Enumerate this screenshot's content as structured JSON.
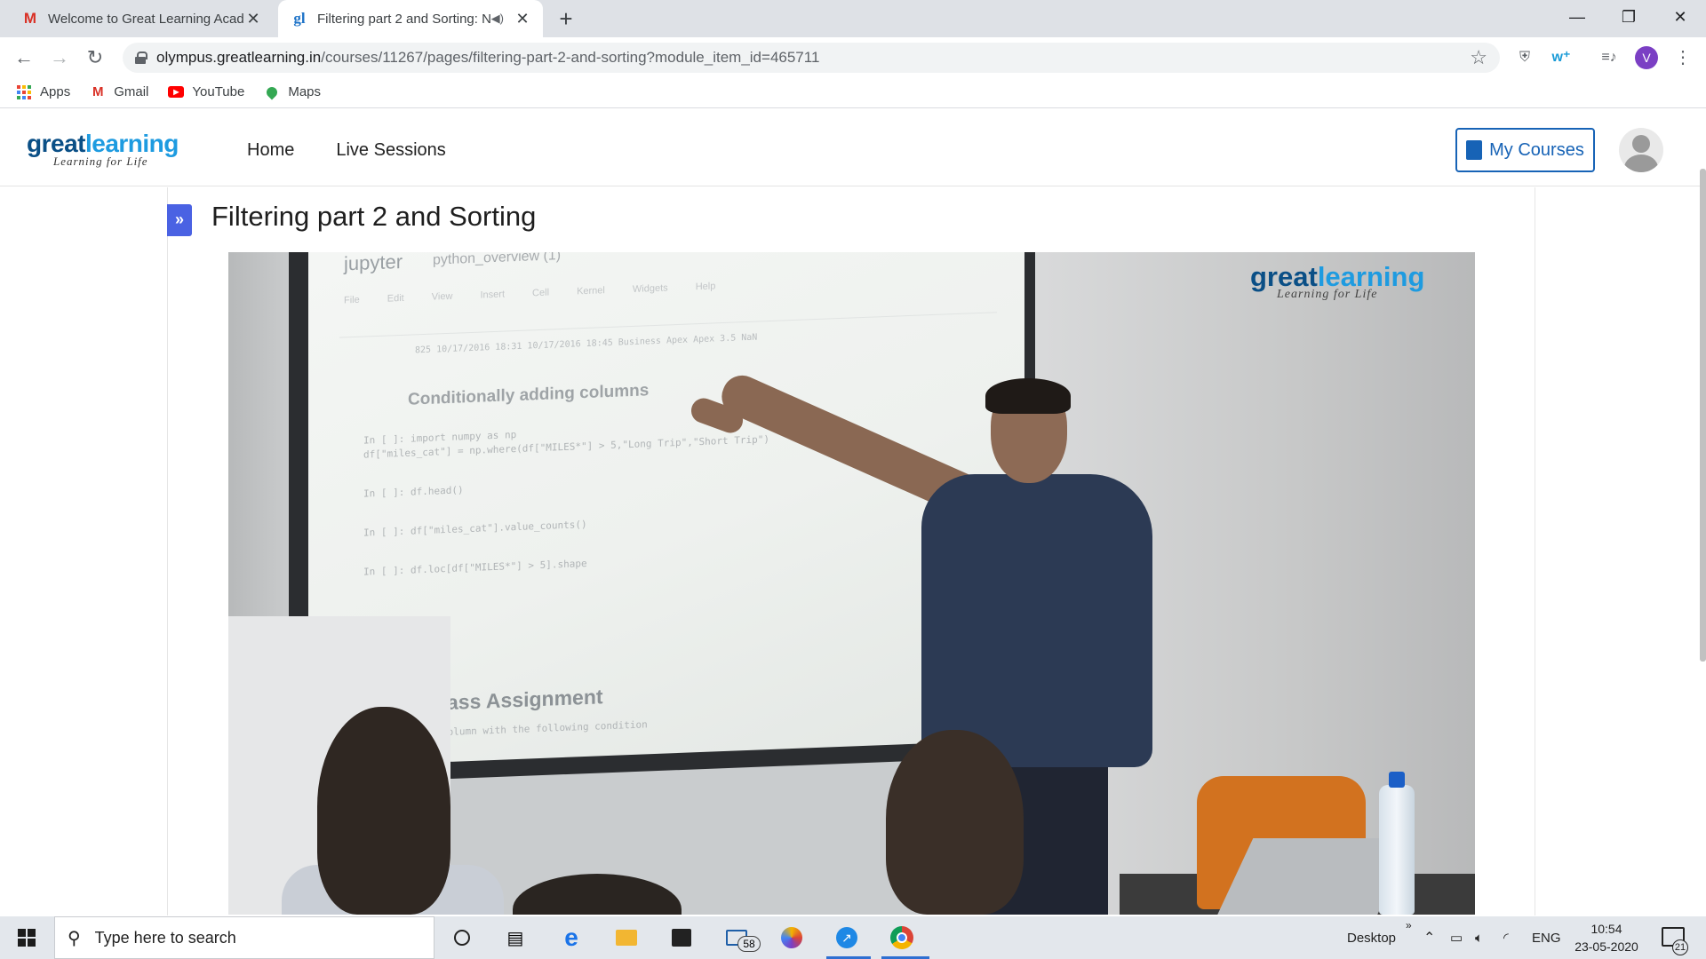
{
  "browser": {
    "tabs": [
      {
        "title": "Welcome to Great Learning Acad",
        "favicon": "gmail-icon",
        "active": false
      },
      {
        "title": "Filtering part 2 and Sorting: N",
        "favicon": "greatlearning-icon",
        "active": true
      }
    ],
    "new_tab": "+",
    "window_controls": {
      "minimize": "—",
      "maximize": "❐",
      "close": "✕"
    },
    "nav": {
      "back": "←",
      "forward": "→",
      "reload": "↻"
    },
    "url_domain": "olympus.greatlearning.in",
    "url_path": "/courses/11267/pages/filtering-part-2-and-sorting?module_item_id=465711",
    "profile_initial": "V",
    "bookmarks": [
      {
        "label": "Apps",
        "icon": "apps-grid-icon"
      },
      {
        "label": "Gmail",
        "icon": "gmail-icon"
      },
      {
        "label": "YouTube",
        "icon": "youtube-icon"
      },
      {
        "label": "Maps",
        "icon": "maps-pin-icon"
      }
    ]
  },
  "site": {
    "logo_word_a": "great",
    "logo_word_b": "learning",
    "logo_tagline": "Learning for Life",
    "nav": [
      {
        "label": "Home"
      },
      {
        "label": "Live Sessions"
      }
    ],
    "my_courses_label": "My Courses",
    "expand_glyph": "»",
    "page_title": "Filtering part 2 and Sorting"
  },
  "video": {
    "watermark_a": "great",
    "watermark_b": "learning",
    "watermark_tagline": "Learning for Life",
    "screen": {
      "jupyter": "jupyter",
      "notebook_name": "python_overview (1)",
      "menu": "File Edit View Insert Cell Kernel Widgets Help",
      "row_line": "825   10/17/2016 18:31   10/17/2016 18:45   Business   Apex   Apex   3.5   NaN",
      "section_heading": "Conditionally adding columns",
      "code_lines": [
        "In [ ]:  import numpy as np",
        "         df[\"miles_cat\"] = np.where(df[\"MILES*\"] > 5,\"Long Trip\",\"Short Trip\")",
        "In [ ]:  df.head()",
        "In [ ]:  df[\"miles_cat\"].value_counts()",
        "In [ ]:  df.loc[df[\"MILES*\"] > 5].shape"
      ],
      "assignment_heading": "In class Assignment",
      "assignment_sub": "column with the following condition"
    }
  },
  "taskbar": {
    "search_placeholder": "Type here to search",
    "mail_badge": "58",
    "desktop_label": "Desktop",
    "language": "ENG",
    "time": "10:54",
    "date": "23-05-2020",
    "notification_count": "21",
    "overflow": "»"
  },
  "colors": {
    "brand_dark": "#0a4f86",
    "brand_light": "#1e9be0",
    "accent_button": "#1763b6",
    "sidebar_toggle": "#4a62e3"
  }
}
